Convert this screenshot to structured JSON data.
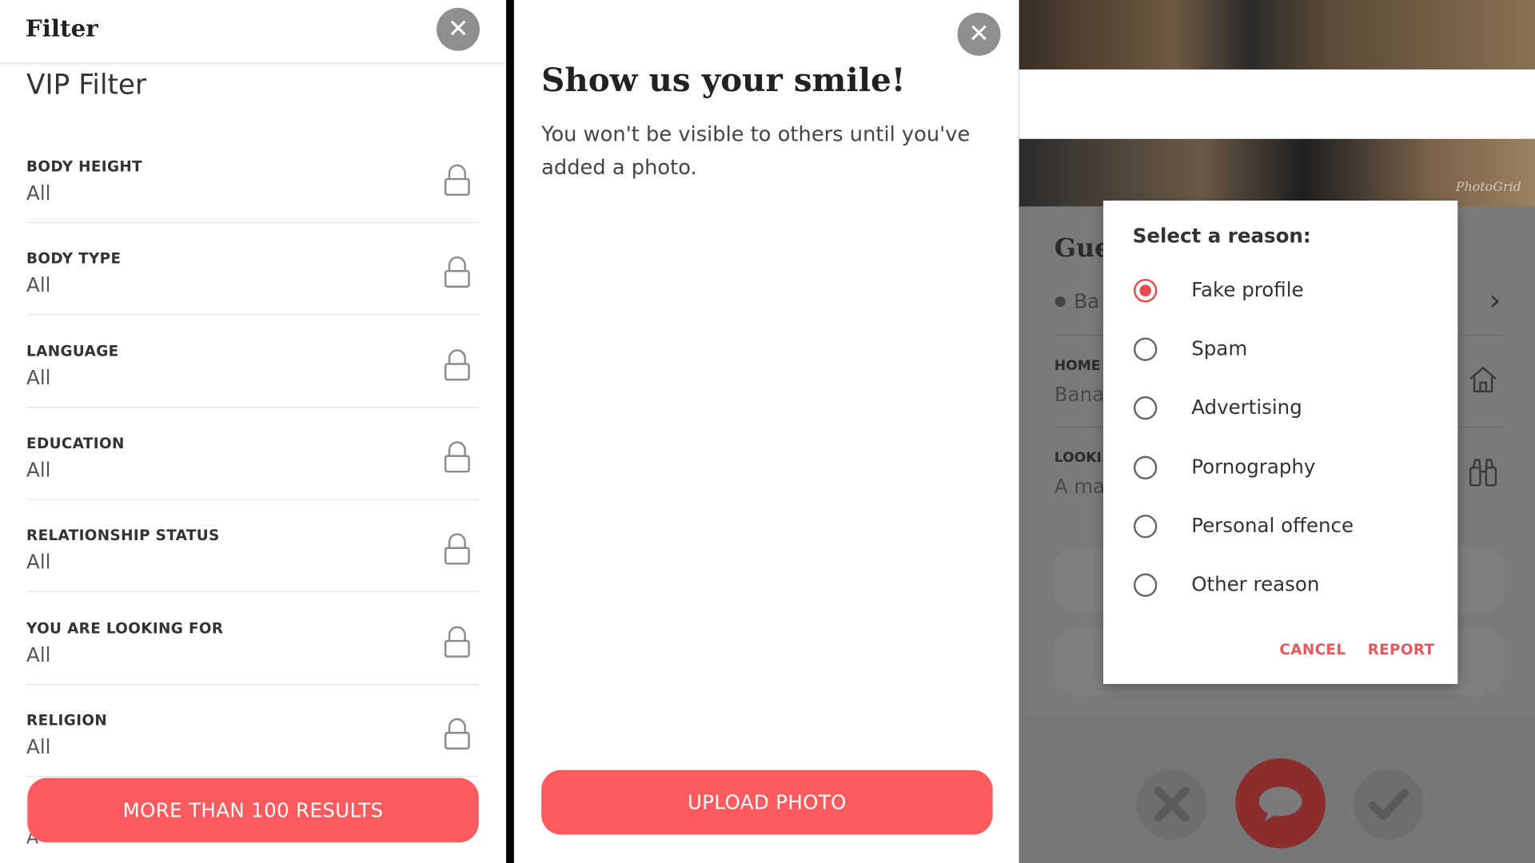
{
  "filter_panel": {
    "title": "Filter",
    "section_title": "VIP Filter",
    "rows": [
      {
        "label": "BODY HEIGHT",
        "value": "All"
      },
      {
        "label": "BODY TYPE",
        "value": "All"
      },
      {
        "label": "LANGUAGE",
        "value": "All"
      },
      {
        "label": "EDUCATION",
        "value": "All"
      },
      {
        "label": "RELATIONSHIP STATUS",
        "value": "All"
      },
      {
        "label": "YOU ARE LOOKING FOR",
        "value": "All"
      },
      {
        "label": "RELIGION",
        "value": "All"
      }
    ],
    "results_button": "MORE THAN 100 RESULTS",
    "truncated_value": "A"
  },
  "photo_panel": {
    "title": "Show us your smile!",
    "message": "You won't be visible to others until you've added a photo.",
    "upload_button": "UPLOAD PHOTO"
  },
  "profile_panel": {
    "watermark": "PhotoGrid",
    "name_partial": "Gue",
    "location_partial": "Ba",
    "hometown_label_partial": "HOME",
    "hometown_value_partial": "Bana",
    "looking_label_partial": "LOOKI",
    "looking_value_partial": "A ma"
  },
  "report_dialog": {
    "title": "Select a reason:",
    "options": [
      "Fake profile",
      "Spam",
      "Advertising",
      "Pornography",
      "Personal offence",
      "Other reason"
    ],
    "selected": "Fake profile",
    "cancel_label": "CANCEL",
    "report_label": "REPORT"
  },
  "colors": {
    "accent": "#fe5b5f",
    "radio_selected": "#e84a4f",
    "dialog_buttons": "#e35a5e"
  }
}
